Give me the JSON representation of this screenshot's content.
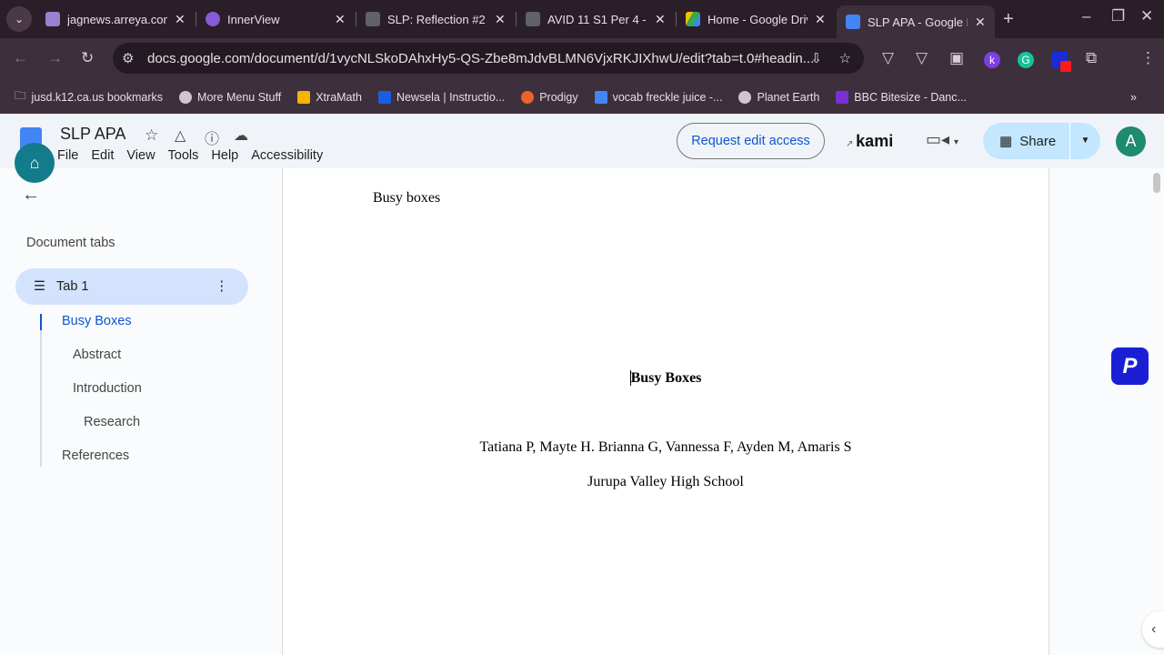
{
  "browser": {
    "tabs": [
      {
        "title": "jagnews.arreya.com",
        "color": "#9b7fd0"
      },
      {
        "title": "InnerView",
        "color": "#8a5bd6"
      },
      {
        "title": "SLP: Reflection #2",
        "color": "#5f6368"
      },
      {
        "title": "AVID 11 S1 Per 4 -",
        "color": "#5f6368"
      },
      {
        "title": "Home - Google Drive",
        "color": "#34a853"
      },
      {
        "title": "SLP APA - Google Docs",
        "color": "#4285f4"
      }
    ],
    "url": "docs.google.com/document/d/1vycNLSkoDAhxHy5-QS-Zbe8mJdvBLMN6VjxRKJIXhwU/edit?tab=t.0#headin...",
    "bookmarks": [
      "jusd.k12.ca.us bookmarks",
      "More Menu Stuff",
      "XtraMath",
      "Newsela | Instructio...",
      "Prodigy",
      "vocab freckle juice -...",
      "Planet Earth",
      "BBC Bitesize - Danc..."
    ]
  },
  "docs": {
    "title": "SLP APA",
    "menu": [
      "File",
      "Edit",
      "View",
      "Tools",
      "Help",
      "Accessibility"
    ],
    "request_edit": "Request edit access",
    "kami": "kami",
    "share": "Share",
    "avatar": "A"
  },
  "sidebar": {
    "heading": "Document tabs",
    "tab": "Tab 1",
    "outline": [
      "Busy Boxes",
      "Abstract",
      "Introduction",
      "Research",
      "References"
    ]
  },
  "page": {
    "header": "Busy boxes",
    "title": "Busy Boxes",
    "authors": "Tatiana P, Mayte H. Brianna G, Vannessa F, Ayden M, Amaris S",
    "school": "Jurupa Valley High School"
  }
}
